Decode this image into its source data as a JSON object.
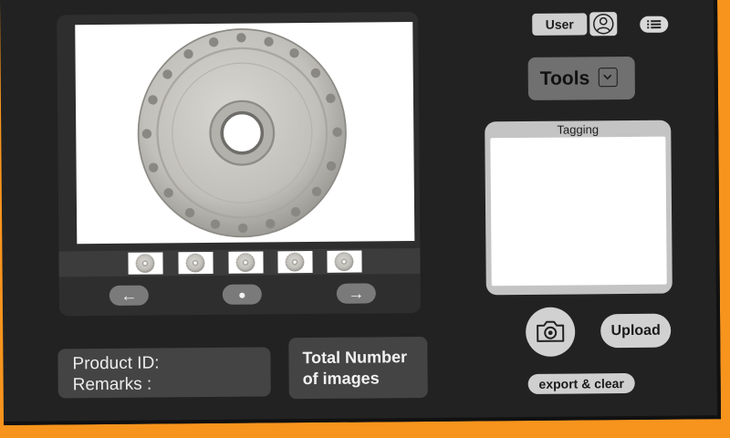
{
  "header": {
    "user_label": "User",
    "user_icon": "user-circle-icon",
    "menu_icon": "list-menu-icon"
  },
  "tools": {
    "label": "Tools",
    "icon": "chevron-down-icon"
  },
  "viewer": {
    "main_image": "wheel-hub-product-image",
    "thumbnails": [
      "thumbnail-1",
      "thumbnail-2",
      "thumbnail-3",
      "thumbnail-4",
      "thumbnail-5"
    ],
    "prev_symbol": "←",
    "next_symbol": "→",
    "indicator_symbol": "●"
  },
  "product": {
    "id_label": "Product ID:",
    "remarks_label": "Remarks :"
  },
  "total": {
    "line1": "Total Number",
    "line2": "of images"
  },
  "tagging": {
    "title": "Tagging",
    "value": ""
  },
  "actions": {
    "camera_icon": "camera-icon",
    "upload_label": "Upload",
    "export_label": "export & clear"
  },
  "colors": {
    "background": "#222222",
    "frame_accent": "#f7941d",
    "button": "#d1d1d1"
  }
}
